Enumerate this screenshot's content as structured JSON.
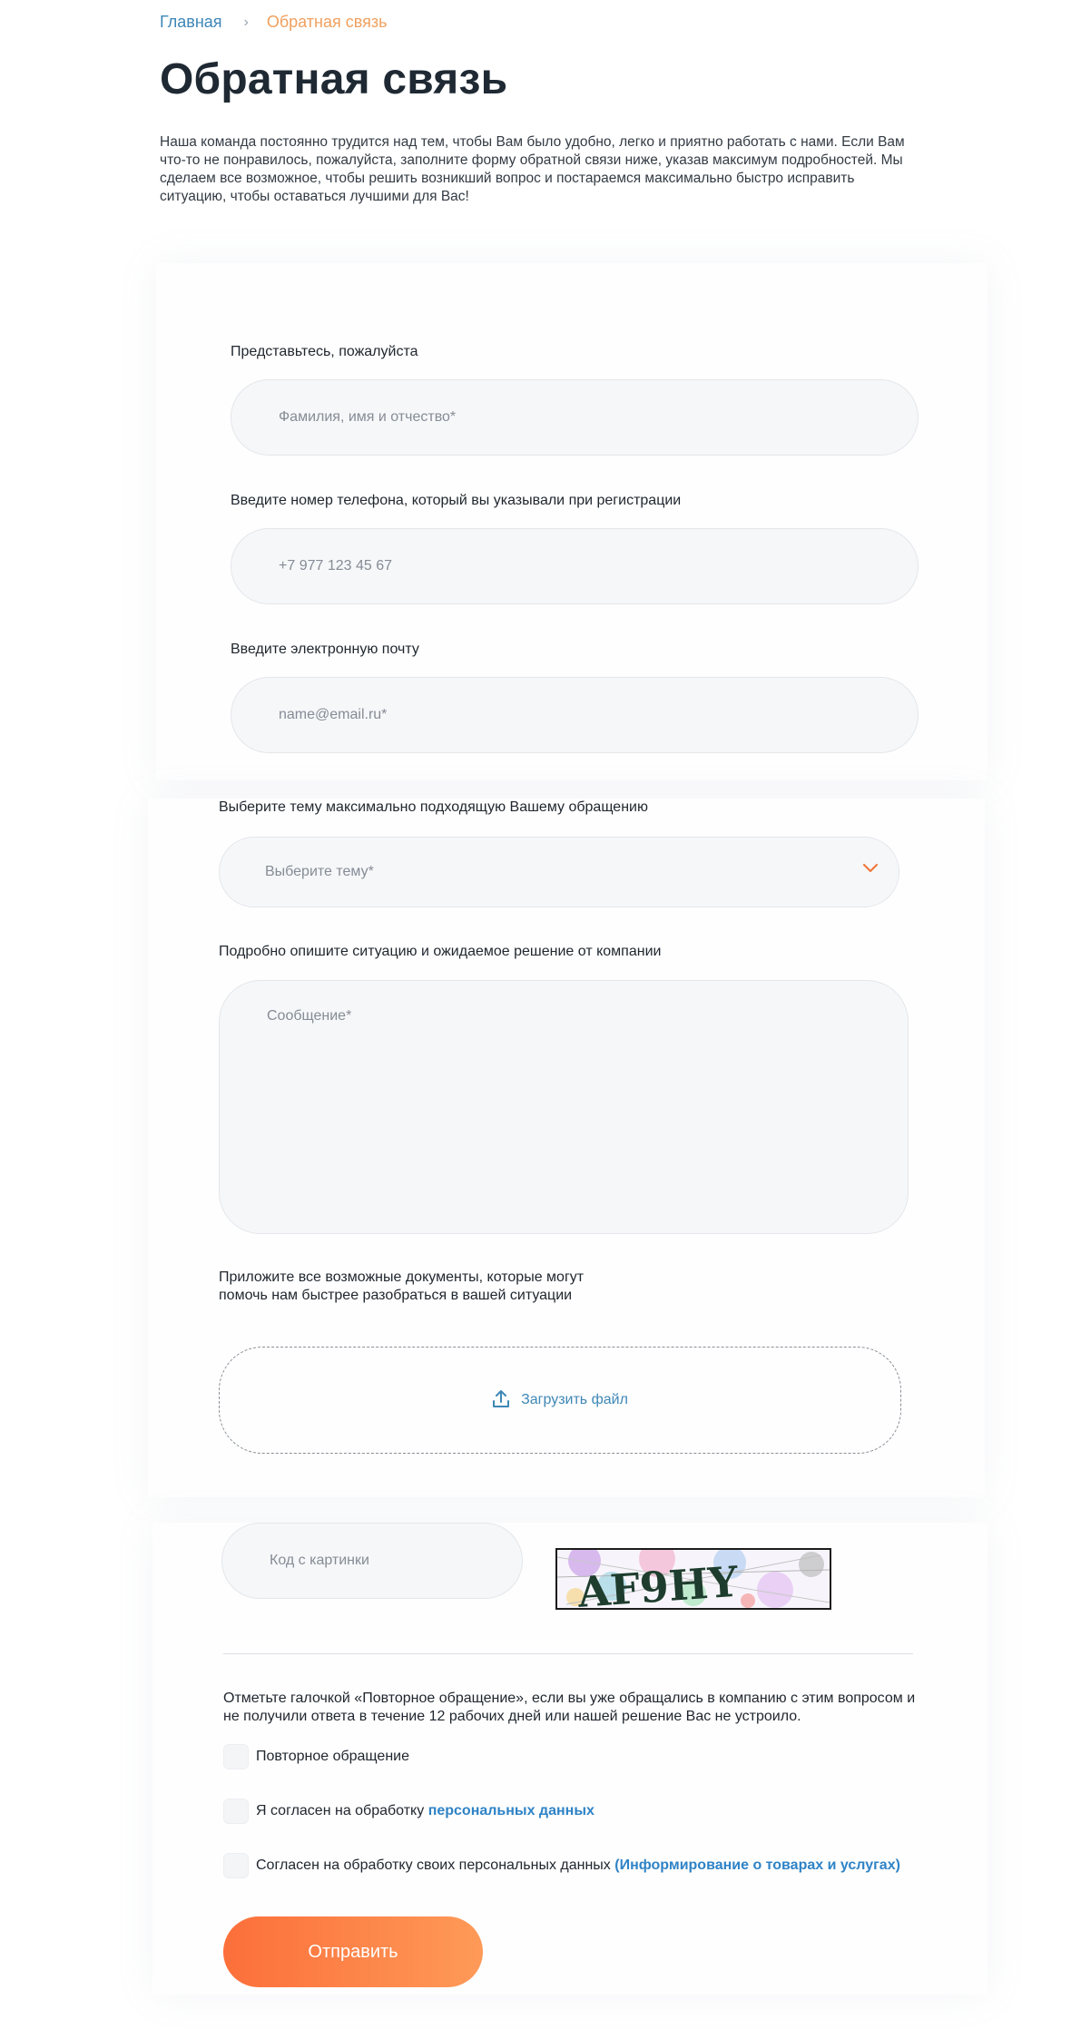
{
  "breadcrumb": {
    "home": "Главная",
    "separator": "›",
    "current": "Обратная связь"
  },
  "page": {
    "title": "Обратная связь",
    "intro": "Наша команда постоянно трудится над тем, чтобы Вам было удобно, легко и приятно работать с нами. Если Вам что-то не понравилось, пожалуйста, заполните форму обратной связи ниже, указав максимум подробностей. Мы сделаем все возможное, чтобы решить возникший вопрос и постараемся максимально быстро исправить ситуацию, чтобы оставаться лучшими для Вас!"
  },
  "form": {
    "name_label": "Представьтесь, пожалуйста",
    "name_placeholder": "Фамилия, имя и отчество*",
    "phone_label": "Введите номер телефона, который вы указывали при регистрации",
    "phone_placeholder": "+7 977 123 45 67",
    "email_label": "Введите электронную почту",
    "email_placeholder": "name@email.ru*",
    "topic_label": "Выберите тему максимально подходящую Вашему обращению",
    "topic_placeholder": "Выберите тему*",
    "message_label": "Подробно опишите ситуацию и ожидаемое решение от компании",
    "message_placeholder": "Сообщение*",
    "attach_label_line1": "Приложите все возможные документы, которые могут",
    "attach_label_line2": "помочь нам быстрее разобраться в вашей ситуации",
    "upload_label": "Загрузить файл",
    "captcha_placeholder": "Код с картинки",
    "captcha_text": "AF9HY",
    "repeat_note": "Отметьте галочкой «Повторное обращение», если вы уже обращались в компанию с этим вопросом и не получили ответа в течение 12 рабочих дней или нашей решение Вас не устроило.",
    "repeat_checkbox": "Повторное обращение",
    "consent_text": "Я согласен на обработку ",
    "consent_link": "персональных данных",
    "marketing_text": "Согласен на обработку своих персональных данных ",
    "marketing_link": "(Информирование о товарах и услугах)",
    "submit_label": "Отправить"
  },
  "colors": {
    "accent": "#fc6f3a",
    "link": "#2f83c6",
    "breadcrumb_current": "#f0a05f"
  },
  "icons": {
    "select": "chevron-down-icon",
    "upload": "upload-icon"
  }
}
